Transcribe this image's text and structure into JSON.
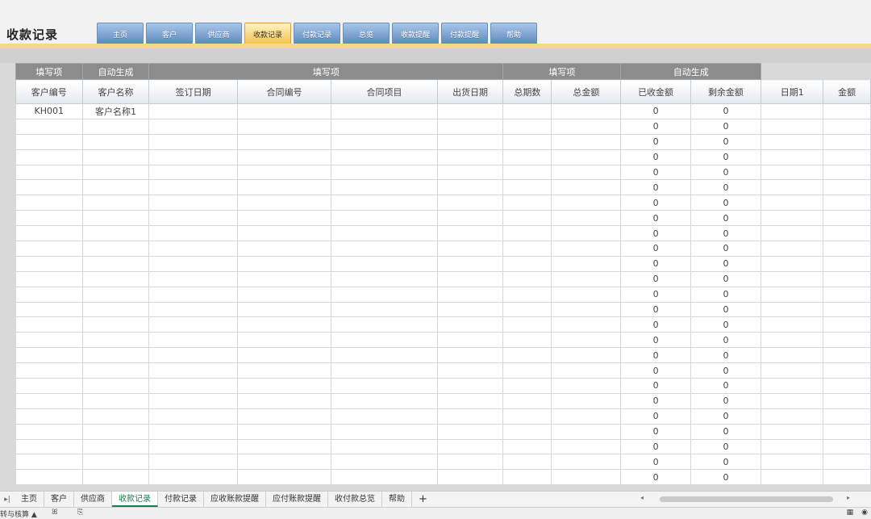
{
  "title": "收款记录",
  "nav_tabs": [
    {
      "label": "主页"
    },
    {
      "label": "客户"
    },
    {
      "label": "供应商"
    },
    {
      "label": "收款记录",
      "active": true
    },
    {
      "label": "付款记录"
    },
    {
      "label": "总览"
    },
    {
      "label": "收款提醒"
    },
    {
      "label": "付款提醒"
    },
    {
      "label": "帮助"
    }
  ],
  "table": {
    "groups": [
      {
        "label": "填写项",
        "span": 1
      },
      {
        "label": "自动生成",
        "span": 1
      },
      {
        "label": "填写项",
        "span": 4
      },
      {
        "label": "填写项",
        "span": 2
      },
      {
        "label": "自动生成",
        "span": 2
      },
      {
        "label": "",
        "span": 2
      }
    ],
    "columns": [
      "客户编号",
      "客户名称",
      "签订日期",
      "合同编号",
      "合同项目",
      "出货日期",
      "总期数",
      "总金额",
      "已收金额",
      "剩余金额",
      "日期1",
      "金额"
    ],
    "first_row": {
      "customer_id": "KH001",
      "customer_name": "客户名称1"
    },
    "received_values": [
      "0",
      "0",
      "0",
      "0",
      "0",
      "0",
      "0",
      "0",
      "0",
      "0",
      "0",
      "0",
      "0",
      "0",
      "0",
      "0",
      "0",
      "0",
      "0",
      "0",
      "0",
      "0",
      "0",
      "0",
      "0"
    ],
    "remaining_values": [
      "0",
      "0",
      "0",
      "0",
      "0",
      "0",
      "0",
      "0",
      "0",
      "0",
      "0",
      "0",
      "0",
      "0",
      "0",
      "0",
      "0",
      "0",
      "0",
      "0",
      "0",
      "0",
      "0",
      "0",
      "0"
    ]
  },
  "sheet_tabs": [
    {
      "label": "主页"
    },
    {
      "label": "客户"
    },
    {
      "label": "供应商"
    },
    {
      "label": "收款记录",
      "active": true
    },
    {
      "label": "付款记录"
    },
    {
      "label": "应收账款提醒"
    },
    {
      "label": "应付账款提醒"
    },
    {
      "label": "收付款总览"
    },
    {
      "label": "帮助"
    }
  ],
  "add_sheet_label": "+",
  "status": {
    "left_text": "转与核算 ▲",
    "icon_1": "ꕤ",
    "icon_2": "⎘",
    "right_1": "▦",
    "right_2": "◉"
  },
  "colors": {
    "accent": "#f6d88a",
    "tab_active": "#f3c24b",
    "tab_inactive": "#5b86bd",
    "header_group": "#8c8c8c",
    "active_sheet": "#1f7a4d"
  }
}
